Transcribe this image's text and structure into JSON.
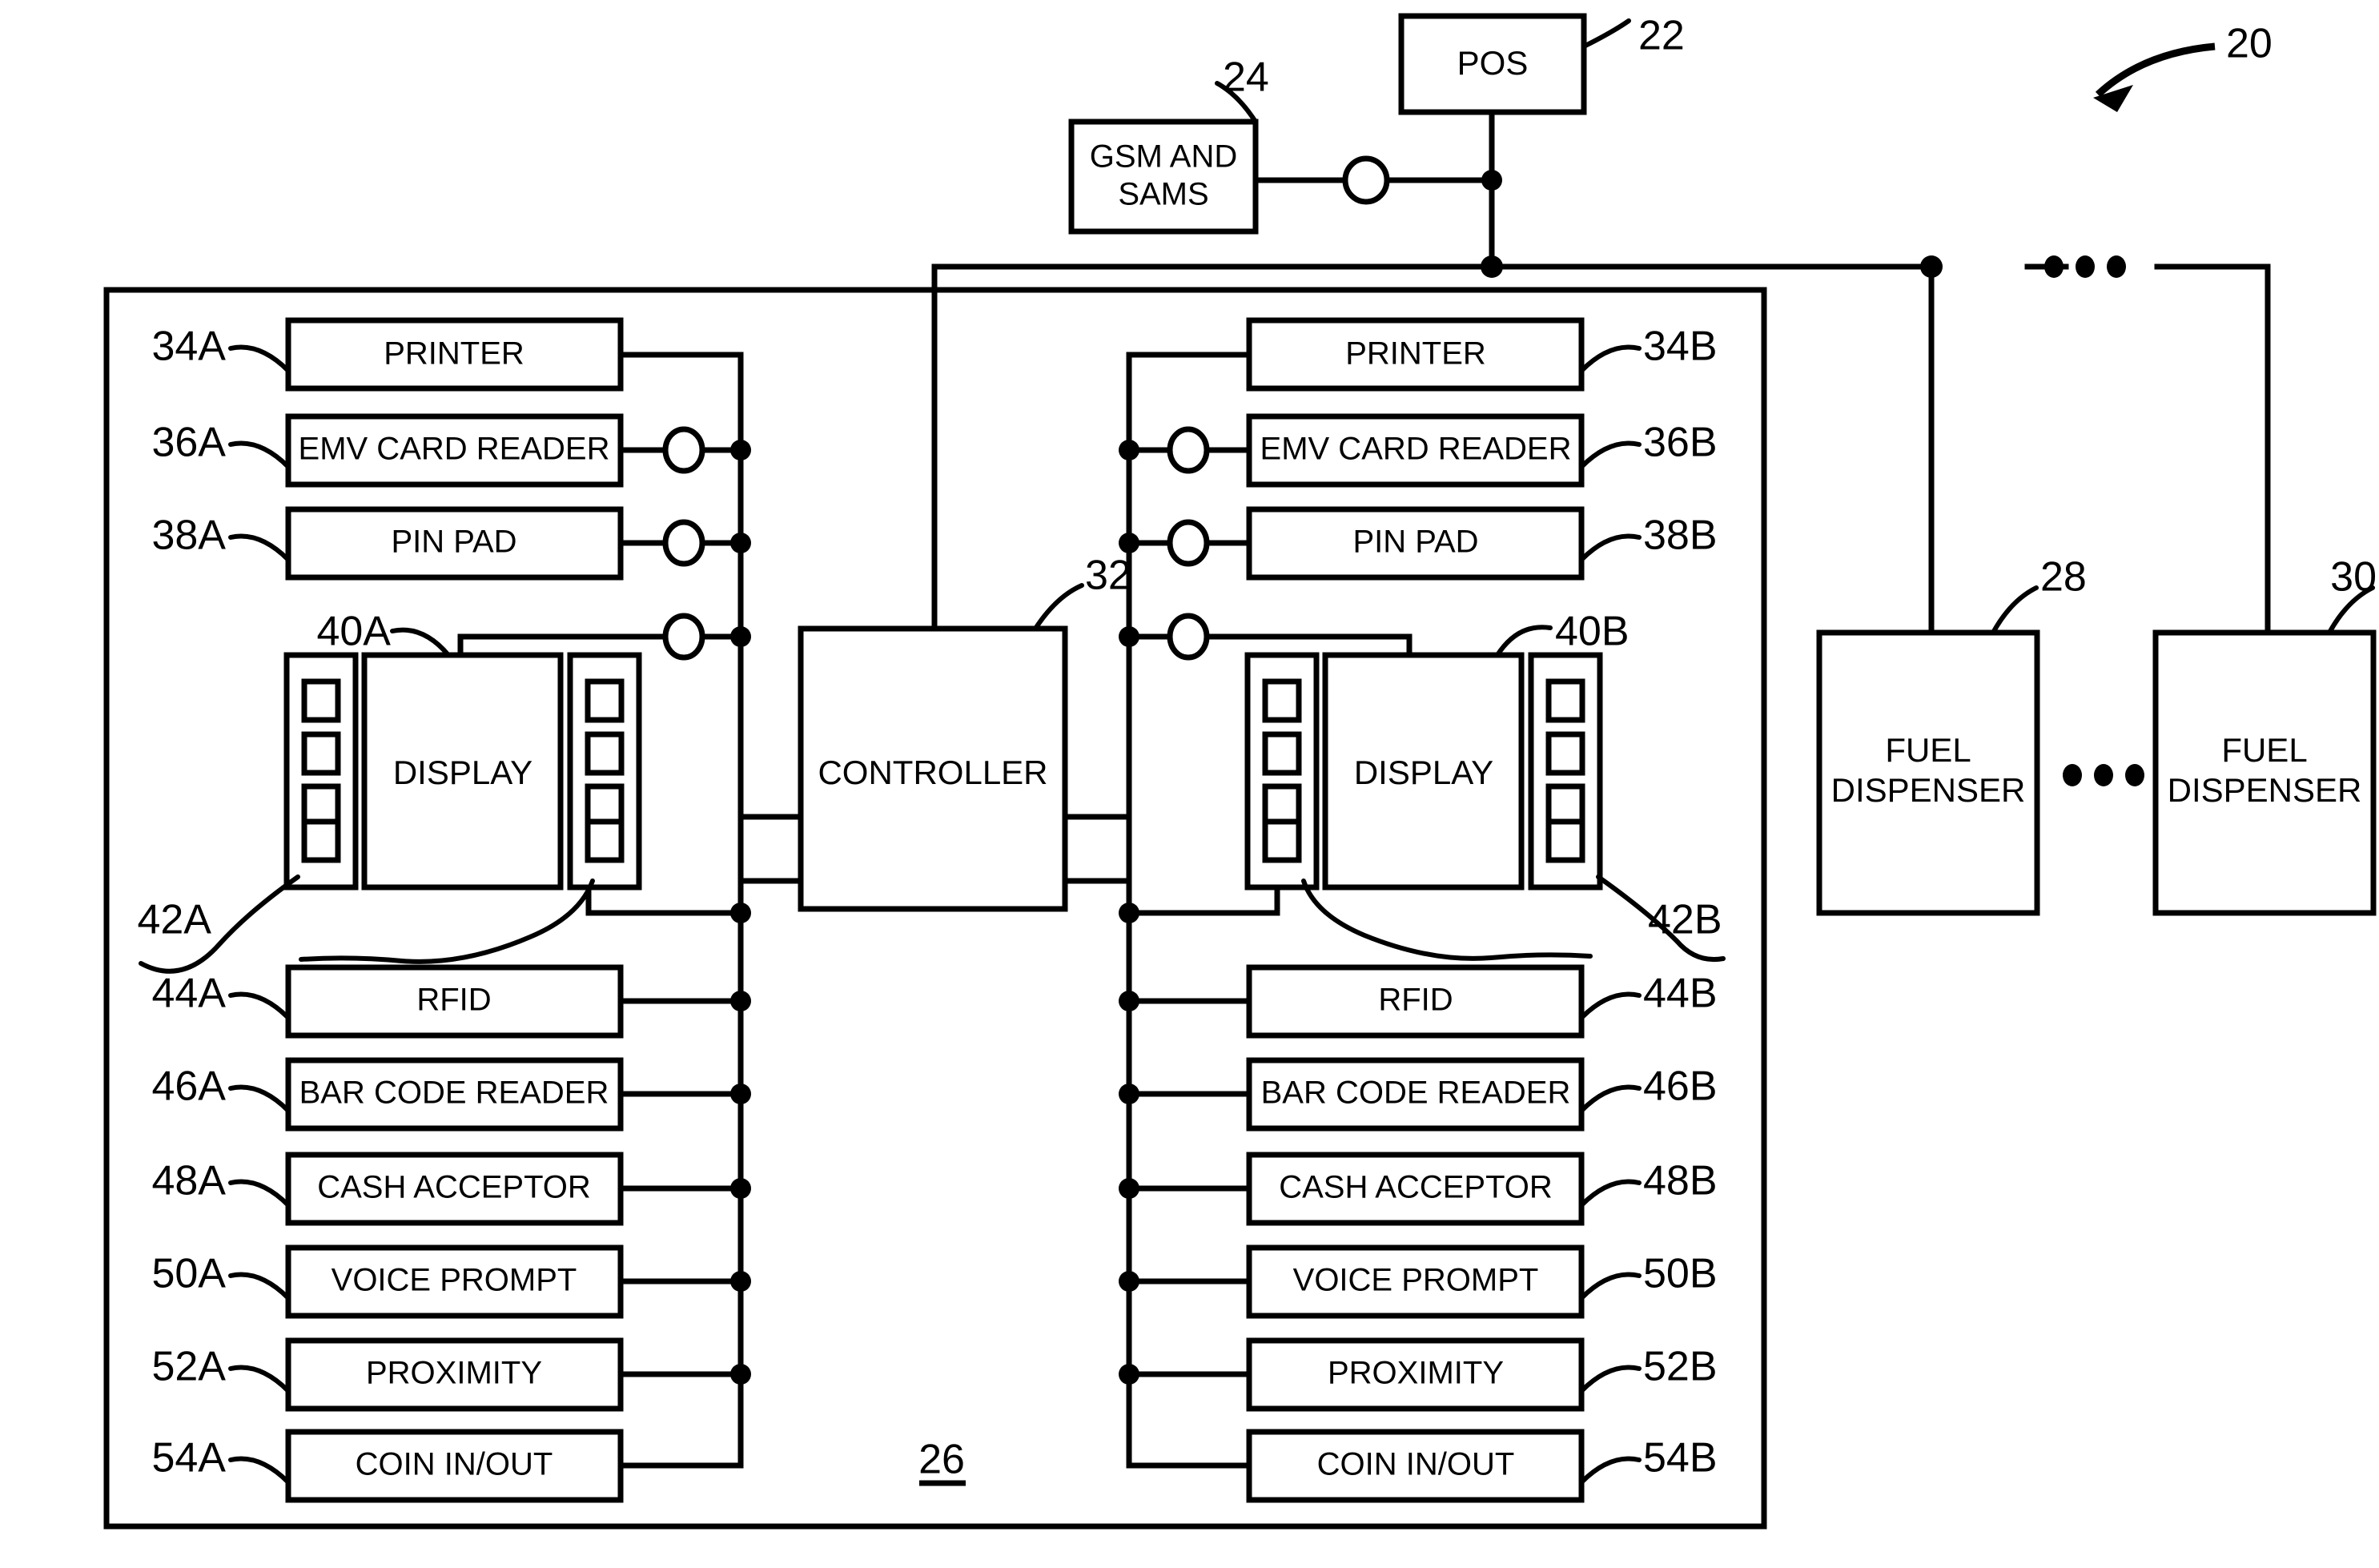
{
  "figure": {
    "system_ref": "20",
    "enclosure_ref": "26",
    "pos": {
      "label": "POS",
      "ref": "22"
    },
    "gsm_sams": {
      "label": "GSM AND SAMS",
      "line1": "GSM AND",
      "line2": "SAMS",
      "ref": "24"
    },
    "controller": {
      "label": "CONTROLLER",
      "ref": "32"
    },
    "fuel_dispensers": [
      {
        "line1": "FUEL",
        "line2": "DISPENSER",
        "ref": "28"
      },
      {
        "line1": "FUEL",
        "line2": "DISPENSER",
        "ref": "30"
      }
    ],
    "ellipsis": "• • •",
    "side_a": {
      "display": {
        "label": "DISPLAY",
        "ref": "40A",
        "softkeys_ref": "42A",
        "softkey_count_per_side": 4
      },
      "peripherals_upper": [
        {
          "label": "PRINTER",
          "ref": "34A",
          "has_interface_node": false
        },
        {
          "label": "EMV CARD READER",
          "ref": "36A",
          "has_interface_node": true
        },
        {
          "label": "PIN PAD",
          "ref": "38A",
          "has_interface_node": true
        }
      ],
      "peripherals_lower": [
        {
          "label": "RFID",
          "ref": "44A"
        },
        {
          "label": "BAR CODE READER",
          "ref": "46A"
        },
        {
          "label": "CASH ACCEPTOR",
          "ref": "48A"
        },
        {
          "label": "VOICE PROMPT",
          "ref": "50A"
        },
        {
          "label": "PROXIMITY",
          "ref": "52A"
        },
        {
          "label": "COIN IN/OUT",
          "ref": "54A"
        }
      ]
    },
    "side_b": {
      "display": {
        "label": "DISPLAY",
        "ref": "40B",
        "softkeys_ref": "42B",
        "softkey_count_per_side": 4
      },
      "peripherals_upper": [
        {
          "label": "PRINTER",
          "ref": "34B",
          "has_interface_node": false
        },
        {
          "label": "EMV CARD READER",
          "ref": "36B",
          "has_interface_node": true
        },
        {
          "label": "PIN PAD",
          "ref": "38B",
          "has_interface_node": true
        }
      ],
      "peripherals_lower": [
        {
          "label": "RFID",
          "ref": "44B"
        },
        {
          "label": "BAR CODE READER",
          "ref": "46B"
        },
        {
          "label": "CASH ACCEPTOR",
          "ref": "48B"
        },
        {
          "label": "VOICE PROMPT",
          "ref": "50B"
        },
        {
          "label": "PROXIMITY",
          "ref": "52B"
        },
        {
          "label": "COIN IN/OUT",
          "ref": "54B"
        }
      ]
    },
    "colors": {
      "ink": "#000000",
      "paper": "#ffffff"
    }
  }
}
